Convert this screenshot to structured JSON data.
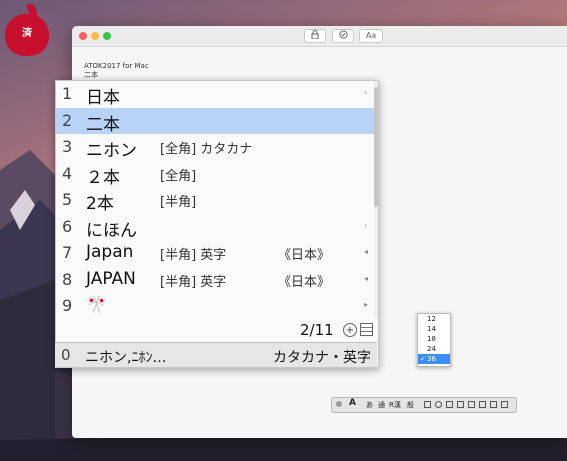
{
  "desktop": {
    "sticker_text": "済"
  },
  "window": {
    "toolbar": {
      "lock_icon": "lock-icon",
      "check_icon": "checkmark-icon",
      "font_label": "Aa"
    },
    "document_lines": [
      "ATOK2017 for Mac",
      "二本"
    ]
  },
  "candidates": {
    "rows": [
      {
        "num": "1",
        "word": "日本",
        "tag": "",
        "extra": "",
        "arrow": "›"
      },
      {
        "num": "2",
        "word": "二本",
        "tag": "",
        "extra": "",
        "arrow": ""
      },
      {
        "num": "3",
        "word": "ニホン",
        "tag": "[全角] カタカナ",
        "extra": "",
        "arrow": ""
      },
      {
        "num": "4",
        "word": "２本",
        "tag": "[全角]",
        "extra": "",
        "arrow": ""
      },
      {
        "num": "5",
        "word": "2本",
        "tag": "[半角]",
        "extra": "",
        "arrow": ""
      },
      {
        "num": "6",
        "word": "にほん",
        "tag": "",
        "extra": "",
        "arrow": "›"
      },
      {
        "num": "7",
        "word": "Japan",
        "tag": "[半角] 英字",
        "extra": "《日本》",
        "arrow": "◂"
      },
      {
        "num": "8",
        "word": "JAPAN",
        "tag": "[半角] 英字",
        "extra": "《日本》",
        "arrow": "◂"
      },
      {
        "num": "9",
        "word": "🎌",
        "tag": "",
        "extra": "",
        "arrow": "▸"
      }
    ],
    "selected_index": 2,
    "pager": "2/11",
    "zoom_icon": "zoom-icon",
    "menu_icon": "menu-icon",
    "bottom": {
      "num": "0",
      "word": "ニホン,ﾆﾎﾝ…",
      "right": "カタカナ・英字"
    }
  },
  "size_menu": {
    "options": [
      "12",
      "14",
      "18",
      "24",
      "36"
    ],
    "selected": "36",
    "check": "✓"
  },
  "palette": {
    "items": [
      "A",
      "あ",
      "通",
      "R漢",
      "般"
    ]
  }
}
